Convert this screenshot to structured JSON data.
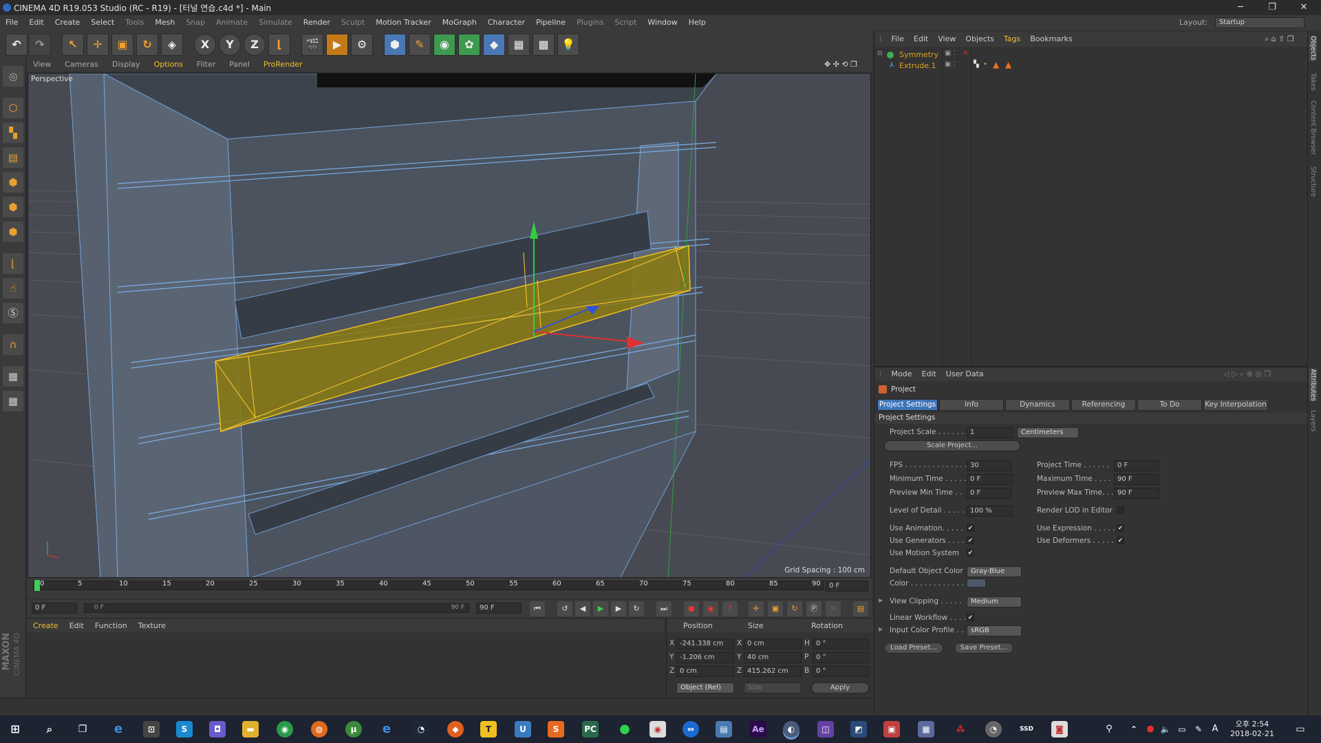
{
  "window": {
    "title": "CINEMA 4D R19.053 Studio (RC - R19) - [터널 연습.c4d *] - Main",
    "minimize": "─",
    "maximize": "❐",
    "close": "✕"
  },
  "menubar": {
    "items": [
      "File",
      "Edit",
      "Create",
      "Select",
      "Tools",
      "Mesh",
      "Snap",
      "Animate",
      "Simulate",
      "Render",
      "Sculpt",
      "Motion Tracker",
      "MoGraph",
      "Character",
      "Pipeline",
      "Plugins",
      "Script",
      "Window",
      "Help"
    ],
    "layout_label": "Layout:",
    "layout_value": "Startup"
  },
  "toolbar": {
    "icons": [
      "undo-icon",
      "redo-icon",
      "live-select-icon",
      "move-icon",
      "scale-icon",
      "rotate-icon",
      "recent-icon",
      "x-axis-icon",
      "y-axis-icon",
      "z-axis-icon",
      "world-coord-icon",
      "render-view-icon",
      "render-picture-viewer-icon",
      "edit-render-settings-icon",
      "cube-icon",
      "pen-spline-icon",
      "subdivision-icon",
      "cloner-icon",
      "deformer-icon",
      "floor-icon",
      "camera-icon",
      "light-icon"
    ],
    "axis_x": "X",
    "axis_y": "Y",
    "axis_z": "Z"
  },
  "viewport": {
    "menu": [
      "View",
      "Cameras",
      "Display",
      "Options",
      "Filter",
      "Panel",
      "ProRender"
    ],
    "label": "Perspective",
    "grid_spacing": "Grid Spacing : 100 cm"
  },
  "timeline": {
    "ticks": [
      "0",
      "5",
      "10",
      "15",
      "20",
      "25",
      "30",
      "35",
      "40",
      "45",
      "50",
      "55",
      "60",
      "65",
      "70",
      "75",
      "80",
      "85",
      "90"
    ],
    "current_frame": "0 F",
    "start_field": "0 F",
    "range_start": "0 F",
    "range_end": "90 F",
    "end_field": "90 F"
  },
  "material_manager": {
    "menu": [
      "Create",
      "Edit",
      "Function",
      "Texture"
    ]
  },
  "coordinates": {
    "headers": [
      "Position",
      "Size",
      "Rotation"
    ],
    "rows": [
      {
        "axis": "X",
        "pos": "-241.338 cm",
        "size_axis": "X",
        "size": "0 cm",
        "rot_axis": "H",
        "rot": "0 °"
      },
      {
        "axis": "Y",
        "pos": "-1.206 cm",
        "size_axis": "Y",
        "size": "40 cm",
        "rot_axis": "P",
        "rot": "0 °"
      },
      {
        "axis": "Z",
        "pos": "0 cm",
        "size_axis": "Z",
        "size": "415.262 cm",
        "rot_axis": "B",
        "rot": "0 °"
      }
    ],
    "mode": "Object (Rel)",
    "size_mode": "Size",
    "apply": "Apply"
  },
  "brand": {
    "top": "MAXON",
    "bottom": "CINEMA 4D"
  },
  "object_manager": {
    "menu": [
      "File",
      "Edit",
      "View",
      "Objects",
      "Tags",
      "Bookmarks"
    ],
    "objects": [
      {
        "name": "Symmetry",
        "color": "#e0a020"
      },
      {
        "name": "Extrude.1",
        "color": "#e0a020"
      }
    ]
  },
  "attributes": {
    "menu": [
      "Mode",
      "Edit",
      "User Data"
    ],
    "header": "Project",
    "tabs": [
      "Project Settings",
      "Info",
      "Dynamics",
      "Referencing",
      "To Do",
      "Key Interpolation"
    ],
    "section": "Project Settings",
    "project_scale_label": "Project Scale . . . . . .",
    "project_scale_value": "1",
    "project_scale_unit": "Centimeters",
    "scale_project_btn": "Scale Project...",
    "fps_label": "FPS . . . . . . . . . . . . . .",
    "fps_value": "30",
    "project_time_label": "Project Time . . . . . .",
    "project_time_value": "0 F",
    "min_time_label": "Minimum Time . . . . .",
    "min_time_value": "0 F",
    "max_time_label": "Maximum Time . . . . .",
    "max_time_value": "90 F",
    "prev_min_label": "Preview Min Time . .",
    "prev_min_value": "0 F",
    "prev_max_label": "Preview Max Time. . .",
    "prev_max_value": "90 F",
    "lod_label": "Level of Detail . . . . .",
    "lod_value": "100 %",
    "render_lod_label": "Render LOD in Editor",
    "use_animation": "Use Animation. . . . .",
    "use_expression": "Use Expression . . . . .",
    "use_generators": "Use Generators . . . .",
    "use_deformers": "Use Deformers . . . . .",
    "use_motion": "Use Motion System",
    "default_color_label": "Default Object Color",
    "default_color_value": "Gray-Blue",
    "color_label": "Color . . . . . . . . . . . .",
    "view_clipping_label": "View Clipping . . . . .",
    "view_clipping_value": "Medium",
    "linear_workflow_label": "Linear Workflow . . . .",
    "input_color_label": "Input Color Profile . .",
    "input_color_value": "sRGB",
    "load_preset": "Load Preset...",
    "save_preset": "Save Preset..."
  },
  "right_tabs": [
    "Objects",
    "Takes",
    "Content Browser",
    "Structure",
    "Attributes",
    "Layers"
  ],
  "taskbar": {
    "time": "오후 2:54",
    "date": "2018-02-21",
    "lang": "A"
  }
}
